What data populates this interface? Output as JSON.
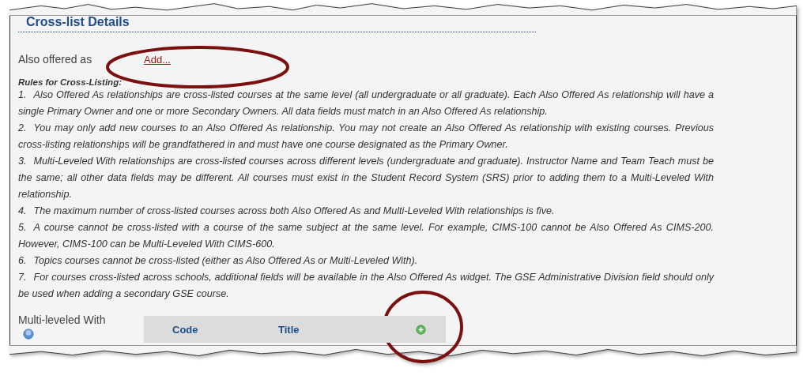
{
  "section": {
    "title": "Cross-list Details"
  },
  "also_offered": {
    "label": "Also offered as",
    "link": "Add..."
  },
  "rules": {
    "heading": "Rules for Cross-Listing:",
    "items": [
      {
        "number": "1.",
        "text": "Also Offered As relationships are cross-listed courses at the same level (all undergraduate or all graduate). Each Also Offered As relationship will have a single Primary Owner and one or more Secondary Owners. All data fields must match in an Also Offered As relationship."
      },
      {
        "number": "2.",
        "text": "You may only add new courses to an Also Offered As relationship. You may not create an Also Offered As relationship with existing courses. Previous cross-listing relationships will be grandfathered in and must have one course designated as the Primary Owner."
      },
      {
        "number": "3.",
        "text": "Multi-Leveled With relationships are cross-listed courses across different levels (undergraduate and graduate). Instructor Name and Team Teach must be the same; all other data fields may be different. All courses must exist in the Student Record System (SRS) prior to adding them to a Multi-Leveled With relationship."
      },
      {
        "number": "4.",
        "text": "The maximum number of cross-listed courses across both Also Offered As and Multi-Leveled With relationships is five."
      },
      {
        "number": "5.",
        "text": "A course cannot be cross-listed with a course of the same subject at the same level. For example, CIMS-100 cannot be Also Offered As CIMS-200. However, CIMS-100 can be Multi-Leveled With CIMS-600."
      },
      {
        "number": "6.",
        "text": "Topics courses cannot be cross-listed (either as Also Offered As or Multi-Leveled With)."
      },
      {
        "number": "7.",
        "text": "For courses cross-listed across schools, additional fields will be available in the Also Offered As widget. The GSE Administrative Division field should only be used when adding a secondary GSE course."
      }
    ]
  },
  "multi_leveled": {
    "label": "Multi-leveled With",
    "columns": [
      "Code",
      "Title"
    ]
  }
}
